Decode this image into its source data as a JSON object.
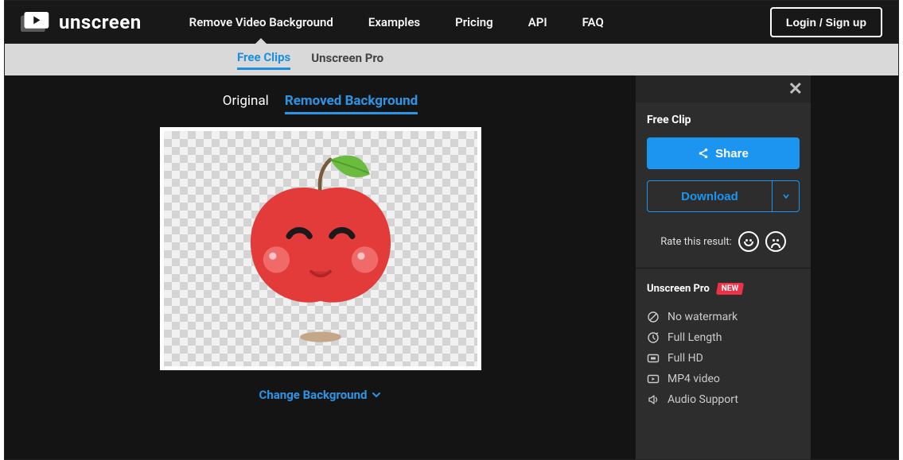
{
  "brand": {
    "name": "unscreen"
  },
  "nav": {
    "remove": "Remove Video Background",
    "examples": "Examples",
    "pricing": "Pricing",
    "api": "API",
    "faq": "FAQ",
    "login": "Login / Sign up"
  },
  "subnav": {
    "free_clips": "Free Clips",
    "pro": "Unscreen Pro"
  },
  "editor": {
    "tab_original": "Original",
    "tab_removed": "Removed Background",
    "change_bg": "Change Background"
  },
  "panel": {
    "title": "Free Clip",
    "share": "Share",
    "download": "Download",
    "rate_label": "Rate this result:",
    "pro_title": "Unscreen Pro",
    "new_badge": "NEW",
    "features": {
      "no_watermark": "No watermark",
      "full_length": "Full Length",
      "full_hd": "Full HD",
      "mp4": "MP4 video",
      "audio": "Audio Support"
    }
  }
}
